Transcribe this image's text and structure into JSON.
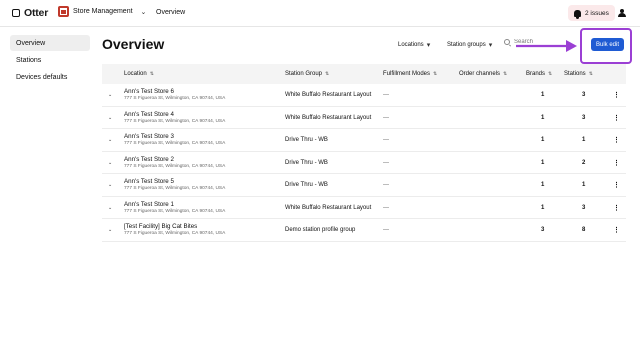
{
  "topbar": {
    "brand": "Otter",
    "store_selector": "Store Management",
    "current_page": "Overview",
    "issues_label": "2 issues"
  },
  "sidebar": {
    "items": [
      {
        "label": "Overview",
        "active": true
      },
      {
        "label": "Stations",
        "active": false
      },
      {
        "label": "Devices defaults",
        "active": false
      }
    ]
  },
  "main": {
    "title": "Overview",
    "filters": {
      "locations": "Locations",
      "station_groups": "Station groups"
    },
    "search_placeholder": "Search",
    "bulk_edit_label": "Bulk edit"
  },
  "table": {
    "headers": {
      "location": "Location",
      "station_group": "Station Group",
      "fulfillment_modes": "Fulfillment Modes",
      "order_channels": "Order channels",
      "brands": "Brands",
      "stations": "Stations"
    },
    "rows": [
      {
        "name": "Ann's Test Store 6",
        "address": "777 S Figueroa St, Wilmington, CA 90744, USA",
        "group": "White Buffalo Restaurant Layout",
        "fulfillment": "—",
        "brands": "1",
        "stations": "3"
      },
      {
        "name": "Ann's Test Store 4",
        "address": "777 S Figueroa St, Wilmington, CA 90744, USA",
        "group": "White Buffalo Restaurant Layout",
        "fulfillment": "—",
        "brands": "1",
        "stations": "3"
      },
      {
        "name": "Ann's Test Store 3",
        "address": "777 S Figueroa St, Wilmington, CA 90744, USA",
        "group": "Drive Thru - WB",
        "fulfillment": "—",
        "brands": "1",
        "stations": "1"
      },
      {
        "name": "Ann's Test Store 2",
        "address": "777 S Figueroa St, Wilmington, CA 90744, USA",
        "group": "Drive Thru - WB",
        "fulfillment": "—",
        "brands": "1",
        "stations": "2"
      },
      {
        "name": "Ann's Test Store 5",
        "address": "777 S Figueroa St, Wilmington, CA 90744, USA",
        "group": "Drive Thru - WB",
        "fulfillment": "—",
        "brands": "1",
        "stations": "1"
      },
      {
        "name": "Ann's Test Store 1",
        "address": "777 S Figueroa St, Wilmington, CA 90744, USA",
        "group": "White Buffalo Restaurant Layout",
        "fulfillment": "—",
        "brands": "1",
        "stations": "3"
      },
      {
        "name": "[Test Facility] Big Cat Bites",
        "address": "777 S Figueroa St, Wilmington, CA 90744, USA",
        "group": "Demo station profile group",
        "fulfillment": "—",
        "brands": "3",
        "stations": "8"
      }
    ]
  },
  "colors": {
    "accent": "#1f5bd3",
    "highlight": "#9b3fd4",
    "issues_bg": "#fbe9ea",
    "store_icon": "#c0392b"
  }
}
